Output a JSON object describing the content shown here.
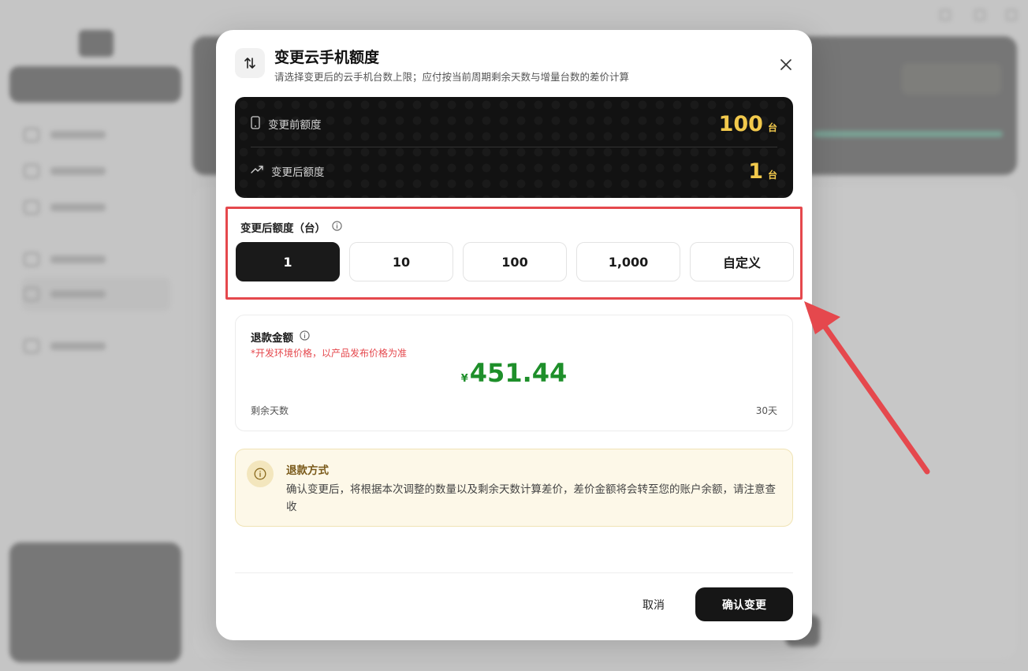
{
  "modal": {
    "title": "变更云手机额度",
    "subtitle": "请选择变更后的云手机台数上限；应付按当前周期剩余天数与增量台数的差价计算"
  },
  "quota": {
    "before_label": "变更前额度",
    "before_value": "100",
    "after_label": "变更后额度",
    "after_value": "1",
    "unit": "台",
    "accent_color": "#f2c94c"
  },
  "selection": {
    "title": "变更后额度（台）",
    "options": [
      "1",
      "10",
      "100",
      "1,000",
      "自定义"
    ],
    "selected": "1"
  },
  "refund": {
    "title": "退款金额",
    "note": "*开发环境价格，以产品发布价格为准",
    "currency": "¥",
    "amount": "451.44",
    "days_label": "剩余天数",
    "days_value": "30天",
    "amount_color": "#1e8f2a"
  },
  "notice": {
    "title": "退款方式",
    "text": "确认变更后，将根据本次调整的数量以及剩余天数计算差价，差价金额将会转至您的账户余额，请注意查收"
  },
  "footer": {
    "cancel_label": "取消",
    "confirm_label": "确认变更"
  },
  "icons": [
    "swap-arrows-icon",
    "close-icon",
    "phone-icon",
    "trend-up-icon",
    "info-icon"
  ],
  "highlight_color": "#e5484d"
}
